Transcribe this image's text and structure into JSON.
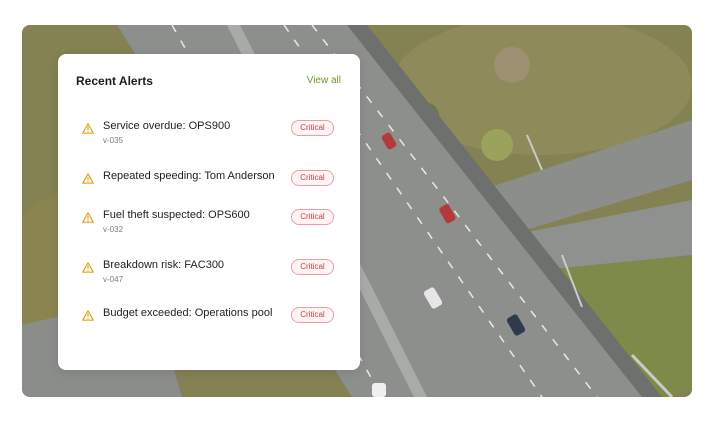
{
  "card": {
    "title": "Recent Alerts",
    "view_all": "View all",
    "accent_color": "#6f9a2a",
    "severity_color": "#d13a44"
  },
  "alerts": [
    {
      "title": "Service overdue: OPS900",
      "vehicle": "v-035",
      "severity": "Critical",
      "icon": "warning-triangle-icon"
    },
    {
      "title": "Repeated speeding: Tom Anderson",
      "vehicle": "",
      "severity": "Critical",
      "icon": "warning-triangle-icon"
    },
    {
      "title": "Fuel theft suspected: OPS600",
      "vehicle": "v-032",
      "severity": "Critical",
      "icon": "warning-triangle-icon"
    },
    {
      "title": "Breakdown risk: FAC300",
      "vehicle": "v-047",
      "severity": "Critical",
      "icon": "warning-triangle-icon"
    },
    {
      "title": "Budget exceeded: Operations pool",
      "vehicle": "",
      "severity": "Critical",
      "icon": "warning-triangle-icon"
    }
  ]
}
